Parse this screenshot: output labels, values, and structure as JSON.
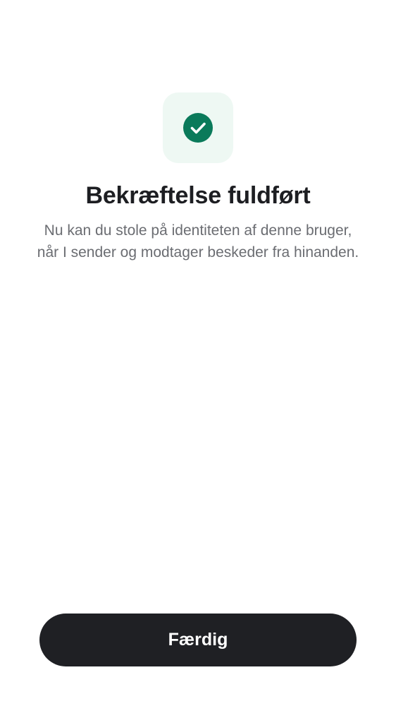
{
  "status": {
    "icon": "check-circle-icon",
    "tile_color": "#eef8f3",
    "accent_color": "#0a7a5a"
  },
  "title": "Bekræftelse fuldført",
  "description": {
    "line1": "Nu kan du stole på identiteten af denne bruger,",
    "line2": "når I sender og modtager beskeder fra hinanden."
  },
  "actions": {
    "done_label": "Færdig"
  }
}
